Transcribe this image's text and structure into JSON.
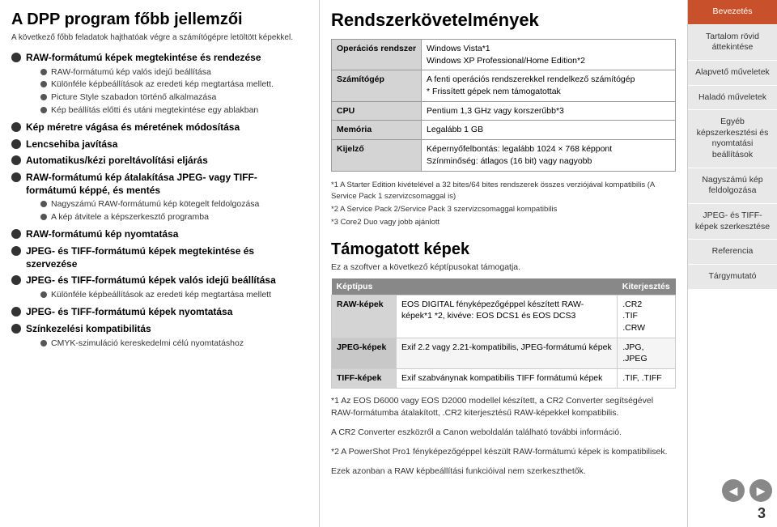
{
  "left": {
    "title": "A DPP program főbb jellemzői",
    "subtitle": "A következő főbb feladatok hajthatóak végre a számítógépre letöltött képekkel.",
    "features": [
      {
        "id": "raw-view",
        "text": "RAW-formátumú képek megtekintése és rendezése",
        "bold": true,
        "sub": [
          "RAW-formátumú kép valós idejű beállítása",
          "Különféle képbeállítások az eredeti kép megtartása mellett.",
          "Picture Style szabadon történő alkalmazása",
          "Kép beállítás előtti és utáni megtekintése egy ablakban"
        ]
      },
      {
        "id": "crop",
        "text": "Kép méretre vágása és méretének módosítása",
        "bold": true
      },
      {
        "id": "lens",
        "text": "Lencsehiba javítása",
        "bold": true
      },
      {
        "id": "dust",
        "text": "Automatikus/kézi poreltávolítási eljárás",
        "bold": true
      },
      {
        "id": "convert",
        "text": "RAW-formátumú kép átalakítása JPEG- vagy TIFF-formátumú képpé, és mentés",
        "bold": true,
        "sub": [
          "Nagyszámú RAW-formátumú kép kötegelt feldolgozása",
          "A kép átvitele a képszerkesztő programba"
        ]
      },
      {
        "id": "print",
        "text": "RAW-formátumú kép nyomtatása",
        "bold": true
      },
      {
        "id": "jpeg-view",
        "text": "JPEG- és TIFF-formátumú képek megtekintése és szervezése",
        "bold": true
      },
      {
        "id": "jpeg-time",
        "text": "JPEG- és TIFF-formátumú képek valós idejű beállítása",
        "bold": true,
        "sub": [
          "Különféle képbeállítások az eredeti kép megtartása mellett"
        ]
      },
      {
        "id": "jpeg-print",
        "text": "JPEG- és TIFF-formátumú képek nyomtatása",
        "bold": true
      },
      {
        "id": "color",
        "text": "Színkezelési kompatibilitás",
        "bold": true,
        "sub": [
          "CMYK-szimuláció kereskedelmi célú nyomtatáshoz"
        ]
      }
    ]
  },
  "middle": {
    "title": "Rendszerkövetelmények",
    "sysreq": {
      "rows": [
        {
          "label": "Operációs rendszer",
          "value": "Windows Vista*1\nWindows XP Professional/Home Edition*2"
        },
        {
          "label": "Számítógép",
          "value": "A fenti operációs rendszerekkel rendelkező számítógép\n* Frissített gépek nem támogatottak"
        },
        {
          "label": "CPU",
          "value": "Pentium 1,3 GHz vagy korszerűbb*3"
        },
        {
          "label": "Memória",
          "value": "Legalább 1 GB"
        },
        {
          "label": "Kijelző",
          "value": "Képernyőfelbontás: legalább 1024 × 768 képpont\nSzínminőség: átlagos (16 bit) vagy nagyobb"
        }
      ]
    },
    "footnotes": [
      "*1  A Starter Edition kivételével a 32 bites/64 bites rendszerek összes verziójával kompatibilis (A Service Pack 1 szervizcsomaggal is)",
      "*2  A Service Pack 2/Service Pack 3 szervizcsomaggal kompatibilis",
      "*3  Core2 Duo vagy jobb ajánlott"
    ],
    "supported": {
      "title": "Támogatott képek",
      "subtitle": "Ez a szoftver a következő képtípusokat támogatja.",
      "headers": [
        "Képtípus",
        "Kiterjesztés"
      ],
      "rows": [
        {
          "type": "RAW-képek",
          "desc": "EOS DIGITAL fényképezőgéppel készített RAW-képek*1 *2, kivéve: EOS DCS1 és EOS DCS3",
          "ext": ".CR2\n.TIF\n.CRW"
        },
        {
          "type": "JPEG-képek",
          "desc": "Exif 2.2 vagy 2.21-kompatibilis, JPEG-formátumú képek",
          "ext": ".JPG, .JPEG"
        },
        {
          "type": "TIFF-képek",
          "desc": "Exif szabványnak kompatibilis TIFF formátumú képek",
          "ext": ".TIF, .TIFF"
        }
      ]
    },
    "footnotes2": [
      "*1  Az EOS D6000 vagy EOS D2000 modellel készített, a CR2 Converter segítségével RAW-formátumba átalakított, .CR2 kiterjesztésű RAW-képekkel kompatibilis.",
      "A CR2 Converter eszközről a Canon weboldalán található további információ.",
      "*2  A PowerShot Pro1 fényképezőgéppel készült RAW-formátumú képek is kompatibilisek.",
      "Ezek azonban a RAW képbeállítási funkcióival nem szerkeszthetők."
    ]
  },
  "sidebar": {
    "items": [
      {
        "id": "bevezetés",
        "label": "Bevezetés",
        "state": "active"
      },
      {
        "id": "tartalom",
        "label": "Tartalom rövid áttekintése",
        "state": "inactive"
      },
      {
        "id": "alapveto",
        "label": "Alapvető műveletek",
        "state": "inactive"
      },
      {
        "id": "halado",
        "label": "Haladó műveletek",
        "state": "inactive"
      },
      {
        "id": "egyeb",
        "label": "Egyéb képszerkesztési és nyomtatási beállítások",
        "state": "inactive"
      },
      {
        "id": "nagy",
        "label": "Nagyszámú kép feldolgozása",
        "state": "inactive"
      },
      {
        "id": "jpeg-tiff",
        "label": "JPEG- és TIFF-képek szerkesztése",
        "state": "inactive"
      },
      {
        "id": "ref",
        "label": "Referencia",
        "state": "inactive"
      },
      {
        "id": "targ",
        "label": "Tárgymutató",
        "state": "inactive"
      }
    ],
    "page": "3",
    "prev_label": "◀",
    "next_label": "▶"
  }
}
